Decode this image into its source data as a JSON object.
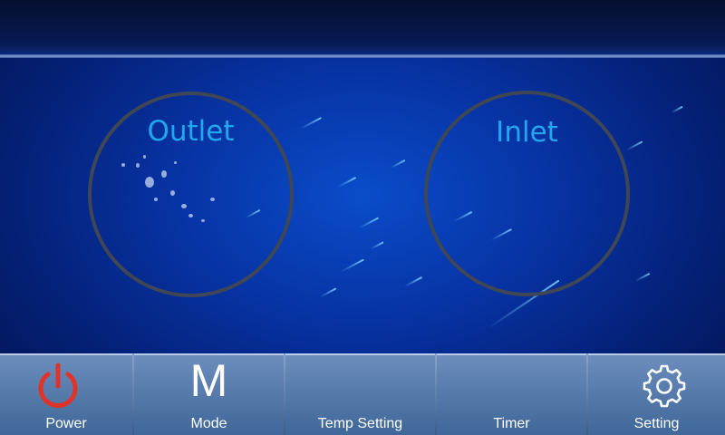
{
  "dials": {
    "outlet": {
      "label": "Outlet"
    },
    "inlet": {
      "label": "Inlet"
    }
  },
  "nav": {
    "items": [
      {
        "id": "power",
        "label": "Power",
        "icon": "power-icon"
      },
      {
        "id": "mode",
        "label": "Mode",
        "glyph": "M",
        "icon": "mode-icon"
      },
      {
        "id": "temp_setting",
        "label": "Temp Setting",
        "icon": ""
      },
      {
        "id": "timer",
        "label": "Timer",
        "icon": ""
      },
      {
        "id": "setting",
        "label": "Setting",
        "icon": "gear-icon"
      }
    ]
  },
  "colors": {
    "accent": "#22a7ee",
    "power_red": "#e0332a",
    "background": "#0734a6"
  }
}
